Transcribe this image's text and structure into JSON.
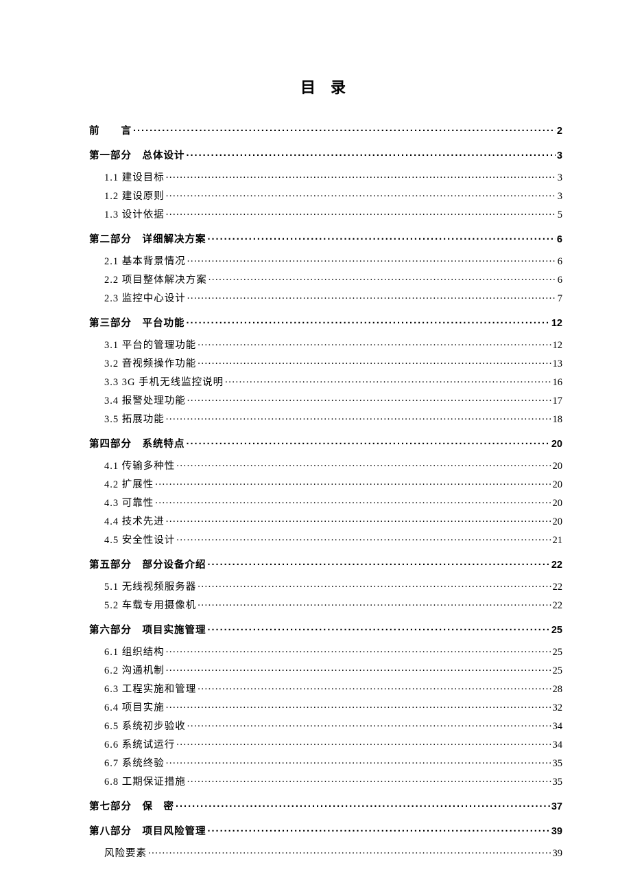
{
  "title": "目 录",
  "entries": [
    {
      "level": 1,
      "label": "前　　言",
      "page": "2"
    },
    {
      "level": 1,
      "label": "第一部分　总体设计",
      "page": "3"
    },
    {
      "level": 2,
      "label": "1.1 建设目标",
      "page": "3"
    },
    {
      "level": 2,
      "label": "1.2 建设原则",
      "page": "3"
    },
    {
      "level": 2,
      "label": "1.3 设计依据",
      "page": "5"
    },
    {
      "level": 1,
      "label": "第二部分　详细解决方案",
      "page": "6"
    },
    {
      "level": 2,
      "label": "2.1 基本背景情况",
      "page": "6"
    },
    {
      "level": 2,
      "label": "2.2 项目整体解决方案",
      "page": "6"
    },
    {
      "level": 2,
      "label": "2.3 监控中心设计",
      "page": "7"
    },
    {
      "level": 1,
      "label": "第三部分　平台功能",
      "page": "12"
    },
    {
      "level": 2,
      "label": "3.1 平台的管理功能",
      "page": "12"
    },
    {
      "level": 2,
      "label": "3.2 音视频操作功能",
      "page": "13"
    },
    {
      "level": 2,
      "label": "3.3 3G 手机无线监控说明",
      "page": "16"
    },
    {
      "level": 2,
      "label": "3.4 报警处理功能",
      "page": "17"
    },
    {
      "level": 2,
      "label": "3.5 拓展功能",
      "page": "18"
    },
    {
      "level": 1,
      "label": "第四部分　系统特点",
      "page": "20"
    },
    {
      "level": 2,
      "label": "4.1 传输多种性",
      "page": "20"
    },
    {
      "level": 2,
      "label": "4.2 扩展性",
      "page": "20"
    },
    {
      "level": 2,
      "label": "4.3 可靠性",
      "page": "20"
    },
    {
      "level": 2,
      "label": "4.4 技术先进",
      "page": "20"
    },
    {
      "level": 2,
      "label": "4.5 安全性设计",
      "page": "21"
    },
    {
      "level": 1,
      "label": "第五部分　部分设备介绍",
      "page": "22"
    },
    {
      "level": 2,
      "label": "5.1 无线视频服务器",
      "page": "22"
    },
    {
      "level": 2,
      "label": "5.2 车载专用摄像机",
      "page": "22"
    },
    {
      "level": 1,
      "label": "第六部分　项目实施管理",
      "page": "25"
    },
    {
      "level": 2,
      "label": "6.1 组织结构",
      "page": "25"
    },
    {
      "level": 2,
      "label": "6.2 沟通机制",
      "page": "25"
    },
    {
      "level": 2,
      "label": "6.3 工程实施和管理",
      "page": "28"
    },
    {
      "level": 2,
      "label": "6.4 项目实施",
      "page": "32"
    },
    {
      "level": 2,
      "label": "6.5 系统初步验收",
      "page": "34"
    },
    {
      "level": 2,
      "label": "6.6 系统试运行",
      "page": "34"
    },
    {
      "level": 2,
      "label": "6.7 系统终验",
      "page": "35"
    },
    {
      "level": 2,
      "label": "6.8 工期保证措施",
      "page": "35"
    },
    {
      "level": 1,
      "label": "第七部分　保　密",
      "page": "37"
    },
    {
      "level": 1,
      "label": "第八部分　项目风险管理",
      "page": "39"
    },
    {
      "level": 2,
      "label": "风险要素",
      "page": "39"
    }
  ]
}
